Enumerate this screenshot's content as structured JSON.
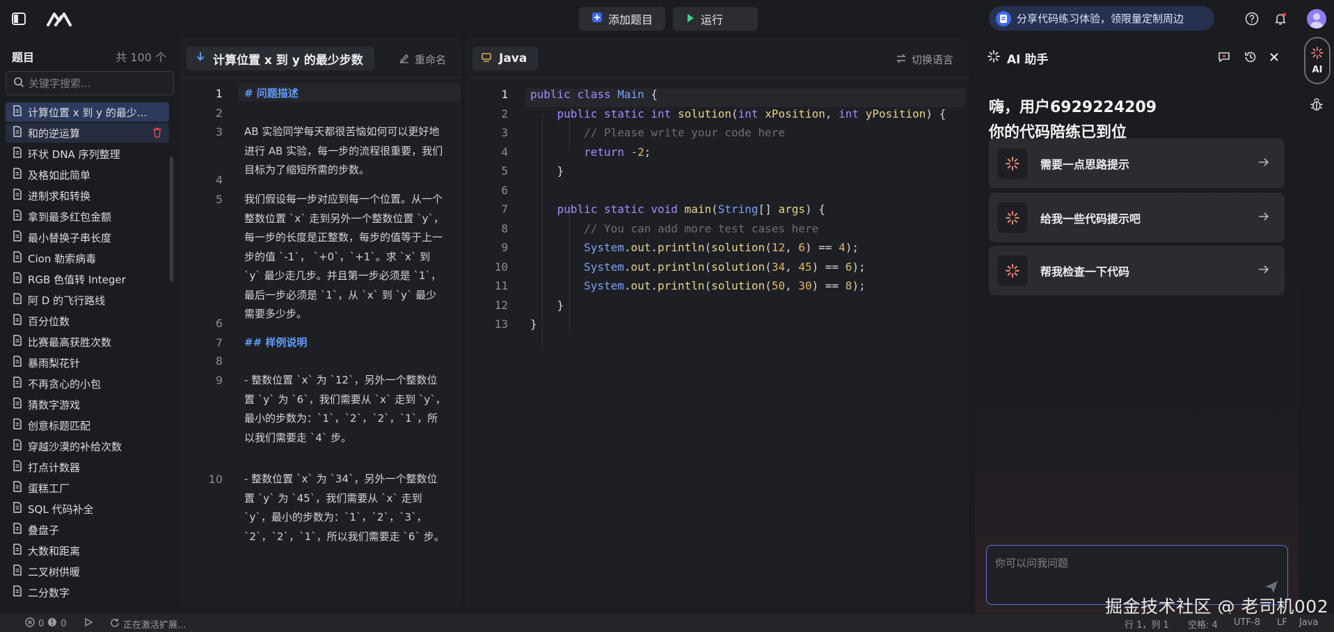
{
  "topbar": {
    "add_problem_label": "添加题目",
    "run_label": "运行",
    "share_text": "分享代码练习体验，领限量定制周边"
  },
  "problem_list": {
    "title": "题目",
    "count": "共 100 个",
    "search_placeholder": "关键字搜索...",
    "items": [
      "计算位置 x 到 y 的最少...",
      "和的逆运算",
      "环状 DNA 序列整理",
      "及格如此简单",
      "进制求和转换",
      "拿到最多红包金额",
      "最小替换子串长度",
      "Cion 勒索病毒",
      "RGB 色值转 Integer",
      "阿 D 的飞行路线",
      "百分位数",
      "比赛最高获胜次数",
      "暴雨梨花针",
      "不再贪心的小包",
      "猜数字游戏",
      "创意标题匹配",
      "穿越沙漠的补给次数",
      "打点计数器",
      "蛋糕工厂",
      "SQL 代码补全",
      "叠盘子",
      "大数和距离",
      "二叉树供暖",
      "二分数字"
    ]
  },
  "description": {
    "tab_title": "计算位置 x 到 y 的最少步数",
    "rename_label": "重命名",
    "lines": [
      {
        "num": "1",
        "text": "# 问题描述",
        "heading": true
      },
      {
        "num": "2",
        "text": ""
      },
      {
        "num": "3",
        "text": "AB 实验同学每天都很苦恼如何可以更好地进行 AB 实验，每一步的流程很重要，我们目标为了缩短所需的步数。"
      },
      {
        "num": "4",
        "text": ""
      },
      {
        "num": "5",
        "text": "我们假设每一步对应到每一个位置。从一个整数位置 `x` 走到另外一个整数位置 `y`，每一步的长度是正整数，每步的值等于上一步的值 `-1`， `+0`，`+1`。求 `x` 到 `y` 最少走几步。并且第一步必须是 `1`，最后一步必须是 `1`，从 `x` 到 `y` 最少需要多少步。"
      },
      {
        "num": "6",
        "text": ""
      },
      {
        "num": "7",
        "text": "## 样例说明",
        "heading": true
      },
      {
        "num": "8",
        "text": ""
      },
      {
        "num": "9",
        "text": "- 整数位置 `x` 为 `12`，另外一个整数位置 `y` 为 `6`，我们需要从 `x` 走到 `y`，最小的步数为：`1`，`2`，`2`，`1`，所以我们需要走 `4` 步。"
      },
      {
        "num": "10",
        "text": "- 整数位置 `x` 为 `34`，另外一个整数位置 `y` 为 `45`，我们需要从 `x` 走到 `y`，最小的步数为：`1`，`2`，`3`，`2`，`2`，`1`，所以我们需要走 `6` 步。"
      }
    ]
  },
  "editor": {
    "language_tab": "Java",
    "switch_language_label": "切换语言",
    "lines": [
      {
        "num": "1",
        "code": "public class Main {"
      },
      {
        "num": "2",
        "code": "    public static int solution(int xPosition, int yPosition) {"
      },
      {
        "num": "3",
        "code": "        // Please write your code here"
      },
      {
        "num": "4",
        "code": "        return -2;"
      },
      {
        "num": "5",
        "code": "    }"
      },
      {
        "num": "6",
        "code": ""
      },
      {
        "num": "7",
        "code": "    public static void main(String[] args) {"
      },
      {
        "num": "8",
        "code": "        // You can add more test cases here"
      },
      {
        "num": "9",
        "code": "        System.out.println(solution(12, 6) == 4);"
      },
      {
        "num": "10",
        "code": "        System.out.println(solution(34, 45) == 6);"
      },
      {
        "num": "11",
        "code": "        System.out.println(solution(50, 30) == 8);"
      },
      {
        "num": "12",
        "code": "    }"
      },
      {
        "num": "13",
        "code": "}"
      }
    ]
  },
  "ai_assistant": {
    "title": "AI 助手",
    "greeting_line1": "嗨，用户6929224209",
    "greeting_line2": "你的代码陪练已到位",
    "suggestions": [
      "需要一点思路提示",
      "给我一些代码提示吧",
      "帮我检查一下代码"
    ],
    "input_placeholder": "你可以问我问题"
  },
  "rail": {
    "ai_label": "AI"
  },
  "statusbar": {
    "errors": "0",
    "warnings": "0",
    "activating": "正在激活扩展...",
    "position": "行 1，列 1",
    "spaces": "空格: 4",
    "encoding": "UTF-8",
    "eol": "LF",
    "language": "Java"
  },
  "watermark": "掘金技术社区 @ 老司机002",
  "colors": {
    "accent_blue": "#3d68f0",
    "keyword": "#a78bfa",
    "type": "#7aa2f7",
    "comment": "#6b6f78",
    "number": "#e0b86b",
    "method": "#e8d58a",
    "heading": "#5f9df7"
  }
}
